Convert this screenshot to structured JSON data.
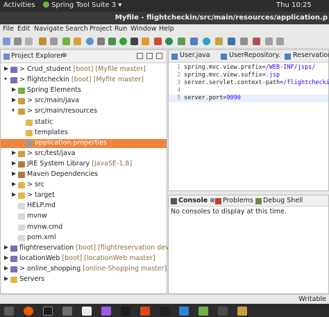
{
  "system_bar": {
    "activities": "Activities",
    "app_name": "Spring Tool Suite 3",
    "time": "Thu 10:25"
  },
  "window": {
    "title": "Myfile - flightcheckin/src/main/resources/application.p"
  },
  "menu": [
    "File",
    "Edit",
    "Navigate",
    "Search",
    "Project",
    "Run",
    "Window",
    "Help"
  ],
  "project_explorer": {
    "title": "Project Explorer",
    "close": "⊗",
    "items": [
      {
        "arrow": "▶",
        "label": "> Crud_student",
        "decoration": " [boot] [Myfile master]",
        "icon": "project-icon"
      },
      {
        "arrow": "▾",
        "label": "> flightcheckin",
        "decoration": " [boot] [Myfile master]",
        "icon": "project-icon"
      },
      {
        "arrow": "▶",
        "label": "Spring Elements",
        "decoration": "",
        "icon": "spring-icon"
      },
      {
        "arrow": "▶",
        "label": "> src/main/java",
        "decoration": "",
        "icon": "source-folder-icon"
      },
      {
        "arrow": "▾",
        "label": "> src/main/resources",
        "decoration": "",
        "icon": "source-folder-icon"
      },
      {
        "arrow": "",
        "label": "static",
        "decoration": "",
        "icon": "folder-icon"
      },
      {
        "arrow": "",
        "label": "templates",
        "decoration": "",
        "icon": "folder-icon"
      },
      {
        "arrow": "",
        "label": "application.properties",
        "decoration": "",
        "icon": "properties-file-icon"
      },
      {
        "arrow": "▶",
        "label": "> src/test/java",
        "decoration": "",
        "icon": "source-folder-icon"
      },
      {
        "arrow": "▶",
        "label": "JRE System Library",
        "decoration": " [JavaSE-1.8]",
        "icon": "library-icon"
      },
      {
        "arrow": "▶",
        "label": "Maven Dependencies",
        "decoration": "",
        "icon": "library-icon"
      },
      {
        "arrow": "▶",
        "label": "> src",
        "decoration": "",
        "icon": "folder-icon"
      },
      {
        "arrow": "▶",
        "label": "> target",
        "decoration": "",
        "icon": "folder-icon"
      },
      {
        "arrow": "",
        "label": "HELP.md",
        "decoration": "",
        "icon": "file-icon"
      },
      {
        "arrow": "",
        "label": "mvnw",
        "decoration": "",
        "icon": "file-icon"
      },
      {
        "arrow": "",
        "label": "mvnw.cmd",
        "decoration": "",
        "icon": "file-icon"
      },
      {
        "arrow": "",
        "label": "pom.xml",
        "decoration": "",
        "icon": "file-icon"
      },
      {
        "arrow": "▶",
        "label": "flightreservation",
        "decoration": " [boot] [flightreservation dev]",
        "icon": "project-icon"
      },
      {
        "arrow": "▶",
        "label": "locationWeb",
        "decoration": " [boot] [locationWeb master]",
        "icon": "project-icon"
      },
      {
        "arrow": "▶",
        "label": "> online_shopping",
        "decoration": " [online-Shopping master]",
        "icon": "project-icon"
      },
      {
        "arrow": "▶",
        "label": "Servers",
        "decoration": "",
        "icon": "folder-icon"
      }
    ],
    "selected_index": 7
  },
  "editor": {
    "tabs": [
      "User.java",
      "UserRepository.",
      "ReservationI"
    ],
    "lines": [
      {
        "num": "1",
        "key": "spring.mvc.view.prefix=",
        "value": "/WEB-INF/jsps/"
      },
      {
        "num": "2",
        "key": "spring.mvc.view.suffix=",
        "value": ".jsp"
      },
      {
        "num": "3",
        "key": "server.servlet.context-path=",
        "value": "/flightcheckin"
      },
      {
        "num": "4",
        "key": "",
        "value": ""
      },
      {
        "num": "5",
        "key": "server.port=",
        "value": "9090"
      }
    ]
  },
  "console": {
    "tabs": [
      "Console",
      "Problems",
      "Debug Shell"
    ],
    "message": "No consoles to display at this time."
  },
  "status": {
    "mode": "Writable"
  },
  "colors": {
    "selection": "#f0843f",
    "value_blue": "#2a00ff",
    "top_bar": "#2c2c2c"
  }
}
